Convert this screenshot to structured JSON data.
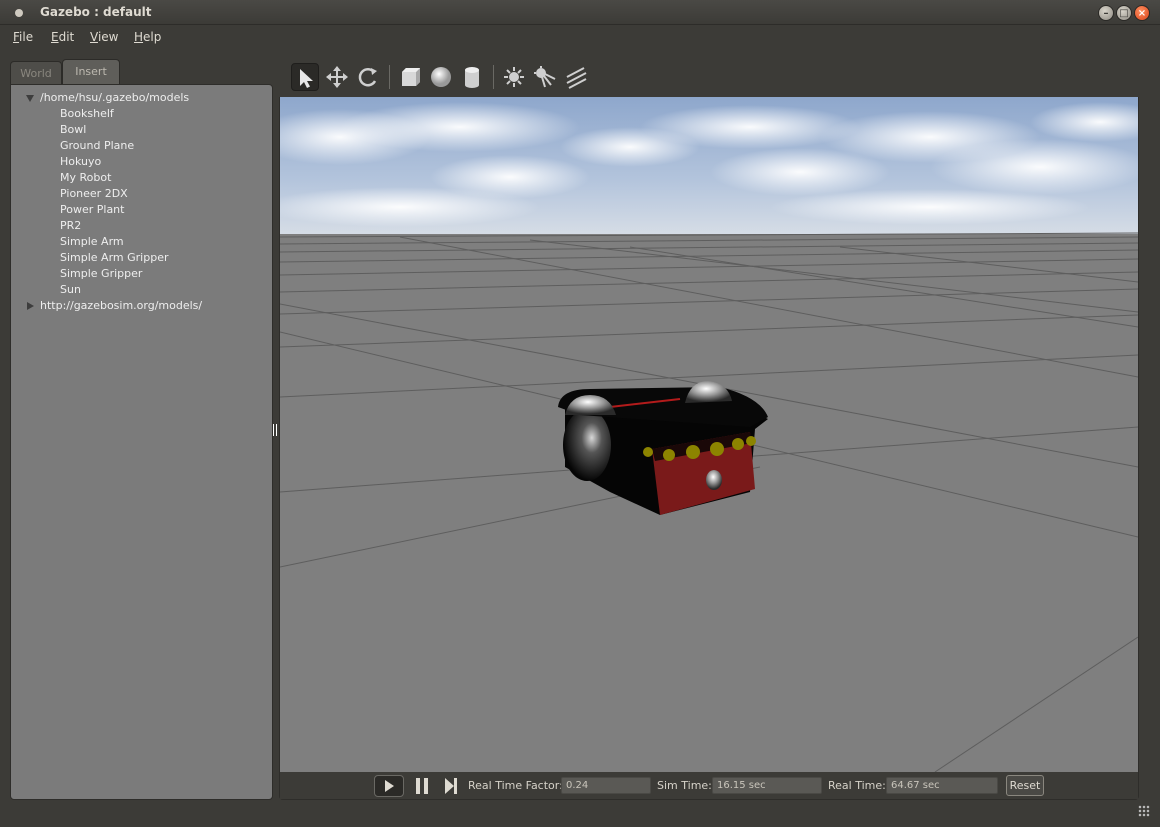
{
  "window": {
    "title": "Gazebo : default"
  },
  "menu": {
    "file": "File",
    "edit": "Edit",
    "view": "View",
    "help": "Help"
  },
  "tabs": {
    "world": "World",
    "insert": "Insert"
  },
  "tree": {
    "root_path": "/home/hsu/.gazebo/models",
    "models": [
      "Bookshelf",
      "Bowl",
      "Ground Plane",
      "Hokuyo",
      "My Robot",
      "Pioneer 2DX",
      "Power Plant",
      "PR2",
      "Simple Arm",
      "Simple Arm Gripper",
      "Simple Gripper",
      "Sun"
    ],
    "remote_path": "http://gazebosim.org/models/"
  },
  "toolbar": {
    "icons": [
      "select-arrow-icon",
      "translate-icon",
      "rotate-icon",
      "box-icon",
      "sphere-icon",
      "cylinder-icon",
      "point-light-icon",
      "spot-light-icon",
      "directional-light-icon"
    ]
  },
  "status": {
    "rtf_label": "Real Time Factor:",
    "rtf_value": "0.24",
    "sim_label": "Sim Time:",
    "sim_value": "16.15 sec",
    "real_label": "Real Time:",
    "real_value": "64.67 sec",
    "reset_label": "Reset"
  },
  "colors": {
    "window_bg": "#3c3b37",
    "tree_bg": "#7b7b7b",
    "ground": "#7f7f7f",
    "sky": "#9fb6d6",
    "robot_body": "#7a1a1a",
    "close_button": "#e0531e"
  }
}
